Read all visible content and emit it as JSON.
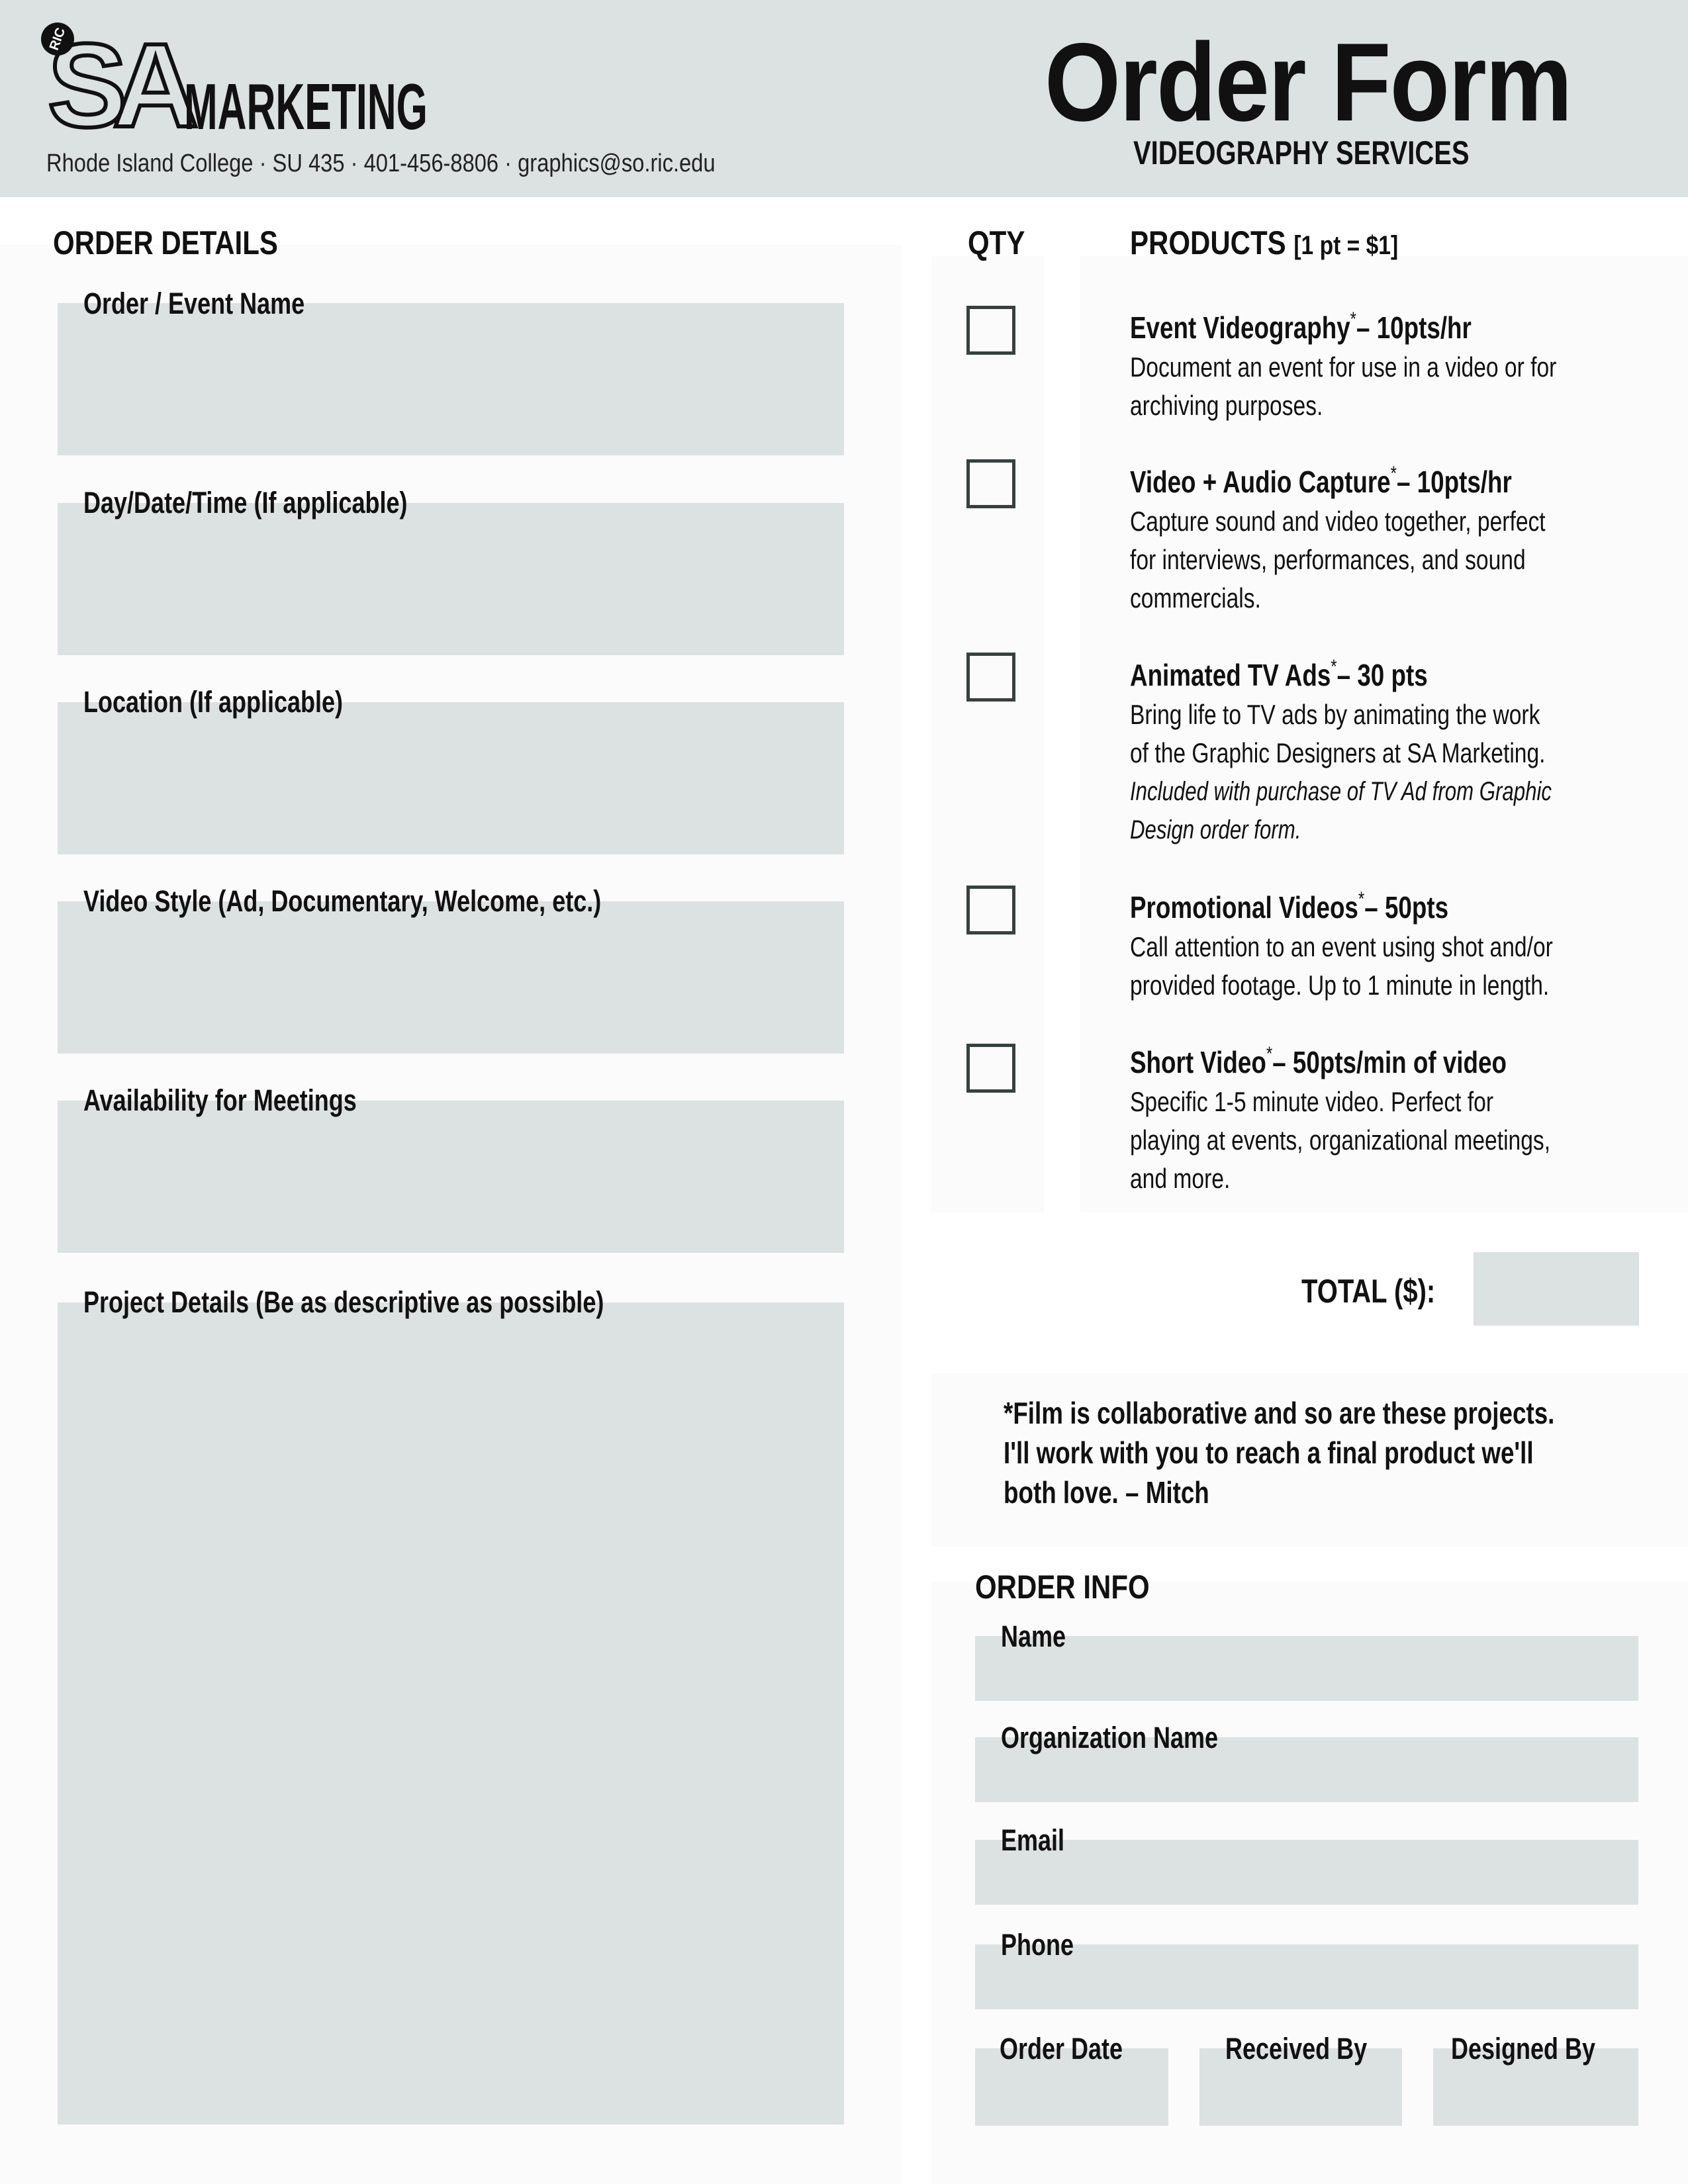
{
  "header": {
    "logo": {
      "badge": "RIC",
      "mark": "SA",
      "word": "MARKETING"
    },
    "contact": "Rhode Island College · SU 435 · 401-456-8806 · graphics@so.ric.edu",
    "title": "Order Form",
    "subtitle": "VIDEOGRAPHY SERVICES"
  },
  "colors": {
    "header_bg": "#dce1e1",
    "field_bg": "#dce1e1",
    "panel_bg": "#fbfbfb",
    "checkbox_border": "#384040"
  },
  "order_details": {
    "heading": "ORDER DETAILS",
    "fields": [
      {
        "label": "Order / Event Name",
        "value": ""
      },
      {
        "label": "Day/Date/Time (If applicable)",
        "value": ""
      },
      {
        "label": "Location (If applicable)",
        "value": ""
      },
      {
        "label": "Video Style (Ad, Documentary, Welcome, etc.)",
        "value": ""
      },
      {
        "label": "Availability for Meetings",
        "value": ""
      },
      {
        "label": "Project Details (Be as descriptive as possible)",
        "value": ""
      }
    ]
  },
  "products": {
    "qty_heading": "QTY",
    "heading": "PRODUCTS",
    "heading_note": "[1 pt = $1]",
    "items": [
      {
        "name": "Event Videography",
        "asterisk": "*",
        "price": "– 10pts/hr",
        "desc_lines": [
          "Document an event for use in a video or for",
          "archiving purposes."
        ],
        "note_lines": [],
        "checked": false
      },
      {
        "name": "Video + Audio Capture",
        "asterisk": "*",
        "price": "– 10pts/hr",
        "desc_lines": [
          "Capture sound and video together, perfect",
          "for interviews, performances, and sound",
          "commercials."
        ],
        "note_lines": [],
        "checked": false
      },
      {
        "name": "Animated TV Ads",
        "asterisk": "*",
        "price": "– 30 pts",
        "desc_lines": [
          "Bring life to TV ads by animating the work",
          "of the Graphic Designers at SA Marketing."
        ],
        "note_lines": [
          "Included with purchase of TV Ad from Graphic",
          "Design order form."
        ],
        "checked": false
      },
      {
        "name": "Promotional Videos",
        "asterisk": "*",
        "price": "– 50pts",
        "desc_lines": [
          "Call attention to an event using shot and/or",
          "provided footage. Up to 1 minute in length."
        ],
        "note_lines": [],
        "checked": false
      },
      {
        "name": "Short Video",
        "asterisk": "*",
        "price": "– 50pts/min of video",
        "desc_lines": [
          "Specific 1-5 minute video. Perfect for",
          "playing at events, organizational meetings,",
          "and more."
        ],
        "note_lines": [],
        "checked": false
      }
    ]
  },
  "total": {
    "label": "TOTAL ($):",
    "value": ""
  },
  "quote": {
    "lines": [
      "*Film is collaborative and so are these projects.",
      "I'll work with you to reach a final product we'll",
      "both love. – Mitch"
    ]
  },
  "order_info": {
    "heading": "ORDER INFO",
    "fields": [
      {
        "label": "Name",
        "value": ""
      },
      {
        "label": "Organization Name",
        "value": ""
      },
      {
        "label": "Email",
        "value": ""
      },
      {
        "label": "Phone",
        "value": ""
      }
    ],
    "bottom_fields": [
      {
        "label": "Order Date",
        "value": ""
      },
      {
        "label": "Received By",
        "value": ""
      },
      {
        "label": "Designed By",
        "value": ""
      }
    ]
  }
}
